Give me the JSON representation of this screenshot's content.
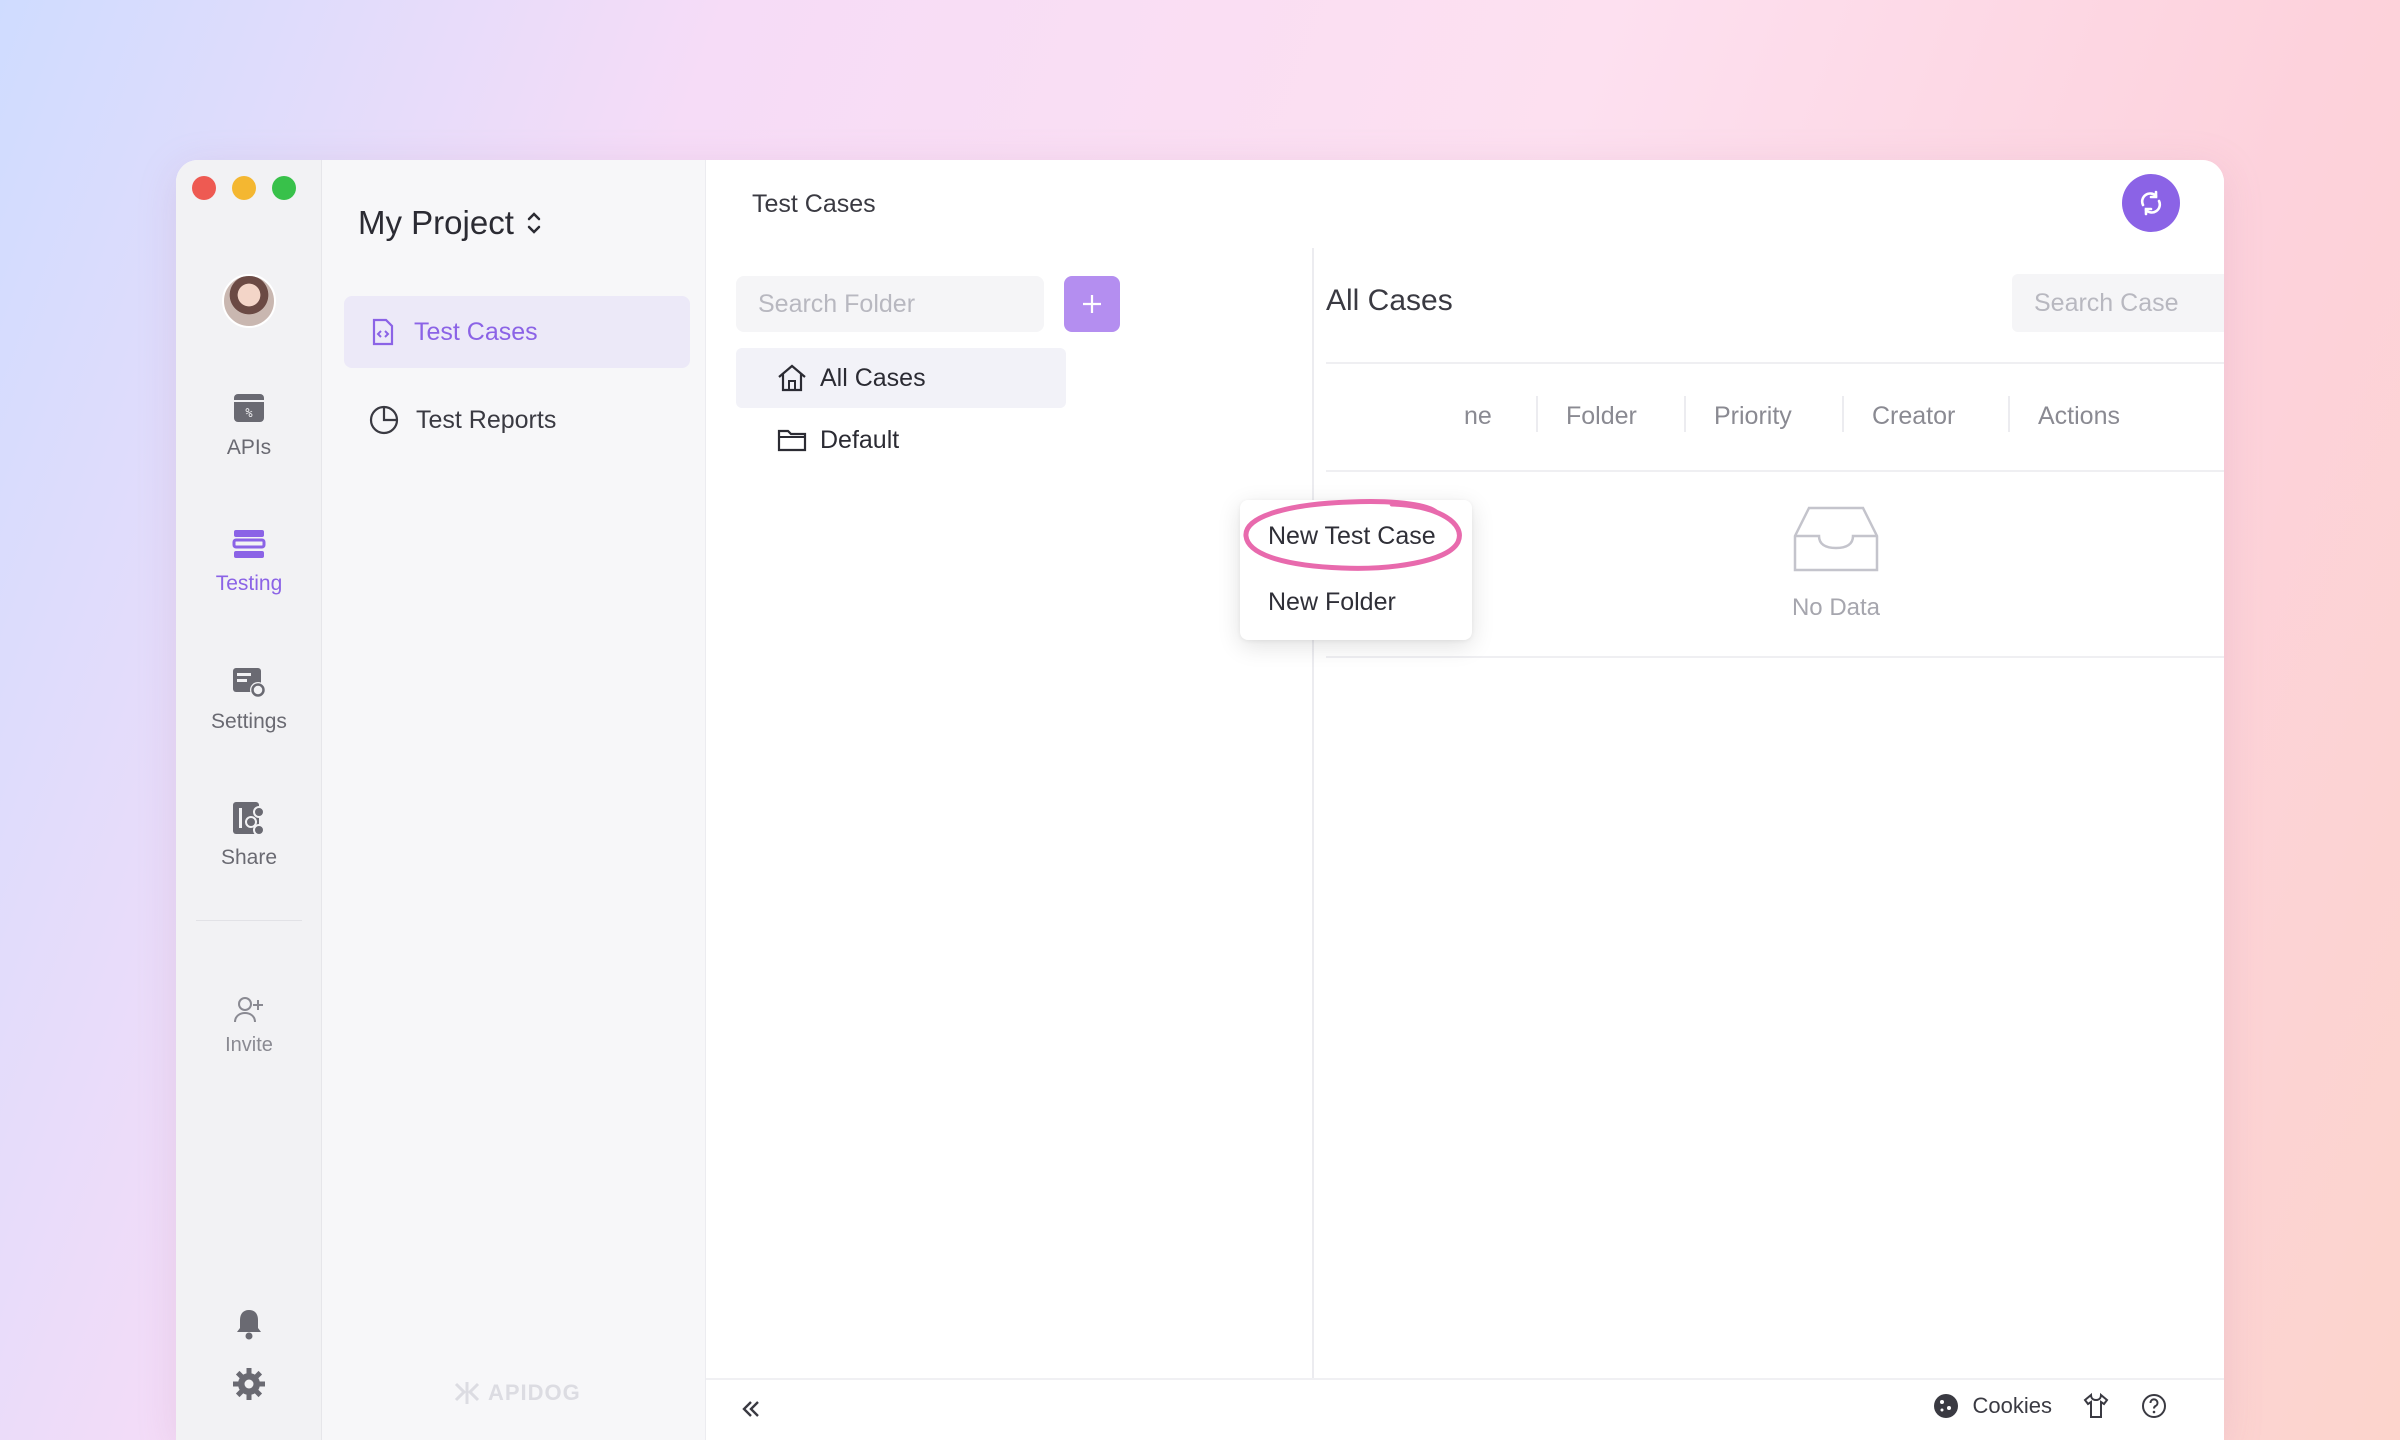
{
  "colors": {
    "accent": "#8b63e6",
    "accent_light": "#b48ef0",
    "annotation": "#e86aad",
    "traffic_red": "#ee5a52",
    "traffic_yellow": "#f4b731",
    "traffic_green": "#38c14a"
  },
  "rail": {
    "items": [
      {
        "label": "APIs",
        "icon": "apis-icon"
      },
      {
        "label": "Testing",
        "icon": "testing-icon"
      },
      {
        "label": "Settings",
        "icon": "settings-icon"
      },
      {
        "label": "Share",
        "icon": "share-icon"
      }
    ],
    "invite_label": "Invite"
  },
  "sidebar": {
    "project_name": "My Project",
    "items": [
      {
        "label": "Test Cases",
        "icon": "test-case-file-icon"
      },
      {
        "label": "Test Reports",
        "icon": "pie-chart-icon"
      }
    ],
    "watermark": "APIDOG"
  },
  "main": {
    "title": "Test Cases",
    "folder_search_placeholder": "Search Folder",
    "tree": [
      {
        "label": "All Cases",
        "icon": "home-icon"
      },
      {
        "label": "Default",
        "icon": "folder-icon"
      }
    ],
    "list_title": "All Cases",
    "case_search_placeholder": "Search Case",
    "columns": [
      "ne",
      "Folder",
      "Priority",
      "Creator",
      "Actions"
    ],
    "empty_text": "No Data"
  },
  "dropdown": {
    "items": [
      "New Test Case",
      "New Folder"
    ]
  },
  "footer": {
    "cookies_label": "Cookies"
  }
}
